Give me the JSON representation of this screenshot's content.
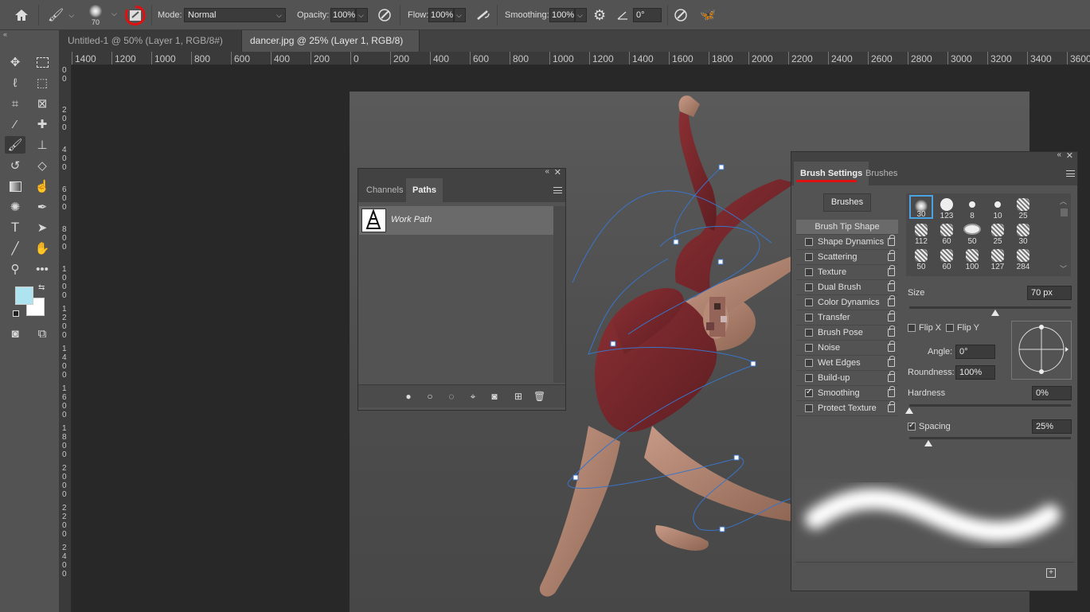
{
  "options_bar": {
    "brush_size": "70",
    "mode_label": "Mode:",
    "mode_value": "Normal",
    "opacity_label": "Opacity:",
    "opacity_value": "100%",
    "flow_label": "Flow:",
    "flow_value": "100%",
    "smoothing_label": "Smoothing:",
    "smoothing_value": "100%",
    "angle_value": "0°"
  },
  "tabs": [
    {
      "label": "Untitled-1 @ 50% (Layer 1, RGB/8#) *",
      "close": "×"
    },
    {
      "label": "dancer.jpg @ 25% (Layer 1, RGB/8) *",
      "close": "×"
    }
  ],
  "ruler_h": [
    "1400",
    "1200",
    "1000",
    "800",
    "600",
    "400",
    "200",
    "0",
    "200",
    "400",
    "600",
    "800",
    "1000",
    "1200",
    "1400",
    "1600",
    "1800",
    "2000",
    "2200",
    "2400",
    "2600",
    "2800",
    "3000",
    "3200",
    "3400",
    "3600"
  ],
  "ruler_v": [
    "0\n0",
    "2\n0\n0",
    "4\n0\n0",
    "6\n0\n0",
    "8\n0\n0",
    "1\n0\n0\n0",
    "1\n2\n0\n0",
    "1\n4\n0\n0",
    "1\n6\n0\n0",
    "1\n8\n0\n0",
    "2\n0\n0\n0",
    "2\n2\n0\n0",
    "2\n4\n0\n0"
  ],
  "paths_panel": {
    "tab_channels": "Channels",
    "tab_paths": "Paths",
    "item": "Work Path"
  },
  "brush_settings": {
    "tab_active": "Brush Settings",
    "tab_other": "Brushes",
    "brushes_button": "Brushes",
    "items": [
      {
        "label": "Brush Tip Shape",
        "check": null
      },
      {
        "label": "Shape Dynamics",
        "check": false
      },
      {
        "label": "Scattering",
        "check": false
      },
      {
        "label": "Texture",
        "check": false
      },
      {
        "label": "Dual Brush",
        "check": false
      },
      {
        "label": "Color Dynamics",
        "check": false
      },
      {
        "label": "Transfer",
        "check": false
      },
      {
        "label": "Brush Pose",
        "check": false
      },
      {
        "label": "Noise",
        "check": false
      },
      {
        "label": "Wet Edges",
        "check": false
      },
      {
        "label": "Build-up",
        "check": false
      },
      {
        "label": "Smoothing",
        "check": true
      },
      {
        "label": "Protect Texture",
        "check": false
      }
    ],
    "presets": [
      "30",
      "123",
      "8",
      "10",
      "25",
      "112",
      "60",
      "50",
      "25",
      "30",
      "50",
      "60",
      "100",
      "127",
      "284"
    ],
    "size_label": "Size",
    "size_value": "70 px",
    "flip_x": "Flip X",
    "flip_y": "Flip Y",
    "angle_label": "Angle:",
    "angle_value": "0°",
    "roundness_label": "Roundness:",
    "roundness_value": "100%",
    "hardness_label": "Hardness",
    "hardness_value": "0%",
    "spacing_label": "Spacing",
    "spacing_value": "25%"
  },
  "colors": {
    "foreground": "#aee4f0",
    "background": "#ffffff",
    "accent": "#4aa3e0",
    "annotation": "#e01010"
  }
}
